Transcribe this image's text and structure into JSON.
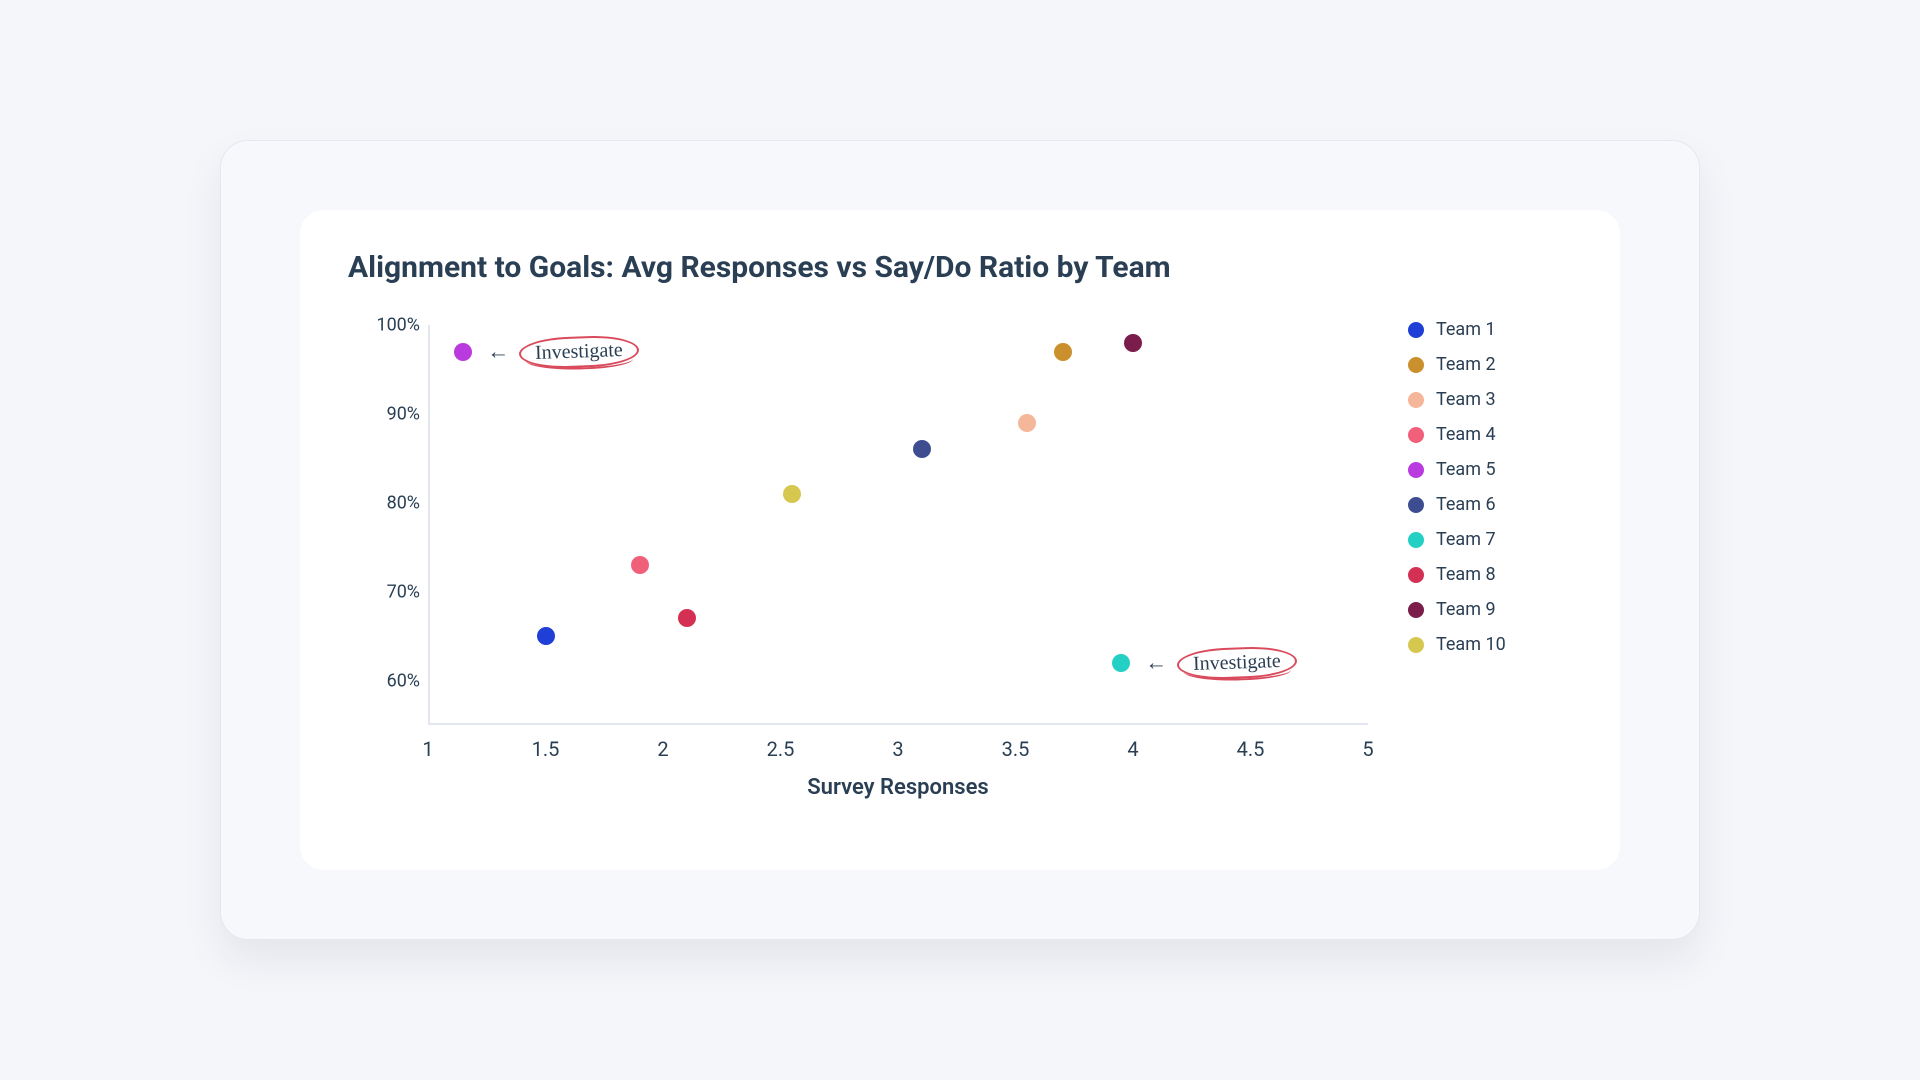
{
  "chart_data": {
    "type": "scatter",
    "title": "Alignment to Goals: Avg Responses vs Say/Do Ratio by Team",
    "xlabel": "Survey Responses",
    "ylabel": "",
    "xlim": [
      1,
      5
    ],
    "ylim": [
      55,
      100
    ],
    "xticks": [
      1,
      1.5,
      2,
      2.5,
      3,
      3.5,
      4,
      4.5,
      5
    ],
    "yticks": [
      60,
      70,
      80,
      90,
      100
    ],
    "ytick_suffix": "%",
    "series": [
      {
        "name": "Team 1",
        "color": "#1f3fd6",
        "x": 1.5,
        "y": 65
      },
      {
        "name": "Team 2",
        "color": "#c9902d",
        "x": 3.7,
        "y": 97
      },
      {
        "name": "Team 3",
        "color": "#f5b79a",
        "x": 3.55,
        "y": 89
      },
      {
        "name": "Team 4",
        "color": "#f0607a",
        "x": 1.9,
        "y": 73
      },
      {
        "name": "Team 5",
        "color": "#b93be0",
        "x": 1.15,
        "y": 97
      },
      {
        "name": "Team 6",
        "color": "#3e4d8f",
        "x": 3.1,
        "y": 86
      },
      {
        "name": "Team 7",
        "color": "#23d0c3",
        "x": 3.95,
        "y": 62
      },
      {
        "name": "Team 8",
        "color": "#d43054",
        "x": 2.1,
        "y": 67
      },
      {
        "name": "Team 9",
        "color": "#7a1d4a",
        "x": 4.0,
        "y": 98
      },
      {
        "name": "Team 10",
        "color": "#d6c84f",
        "x": 2.55,
        "y": 81
      }
    ],
    "annotations": [
      {
        "target": "Team 5",
        "text": "Investigate"
      },
      {
        "target": "Team 7",
        "text": "Investigate"
      }
    ]
  }
}
